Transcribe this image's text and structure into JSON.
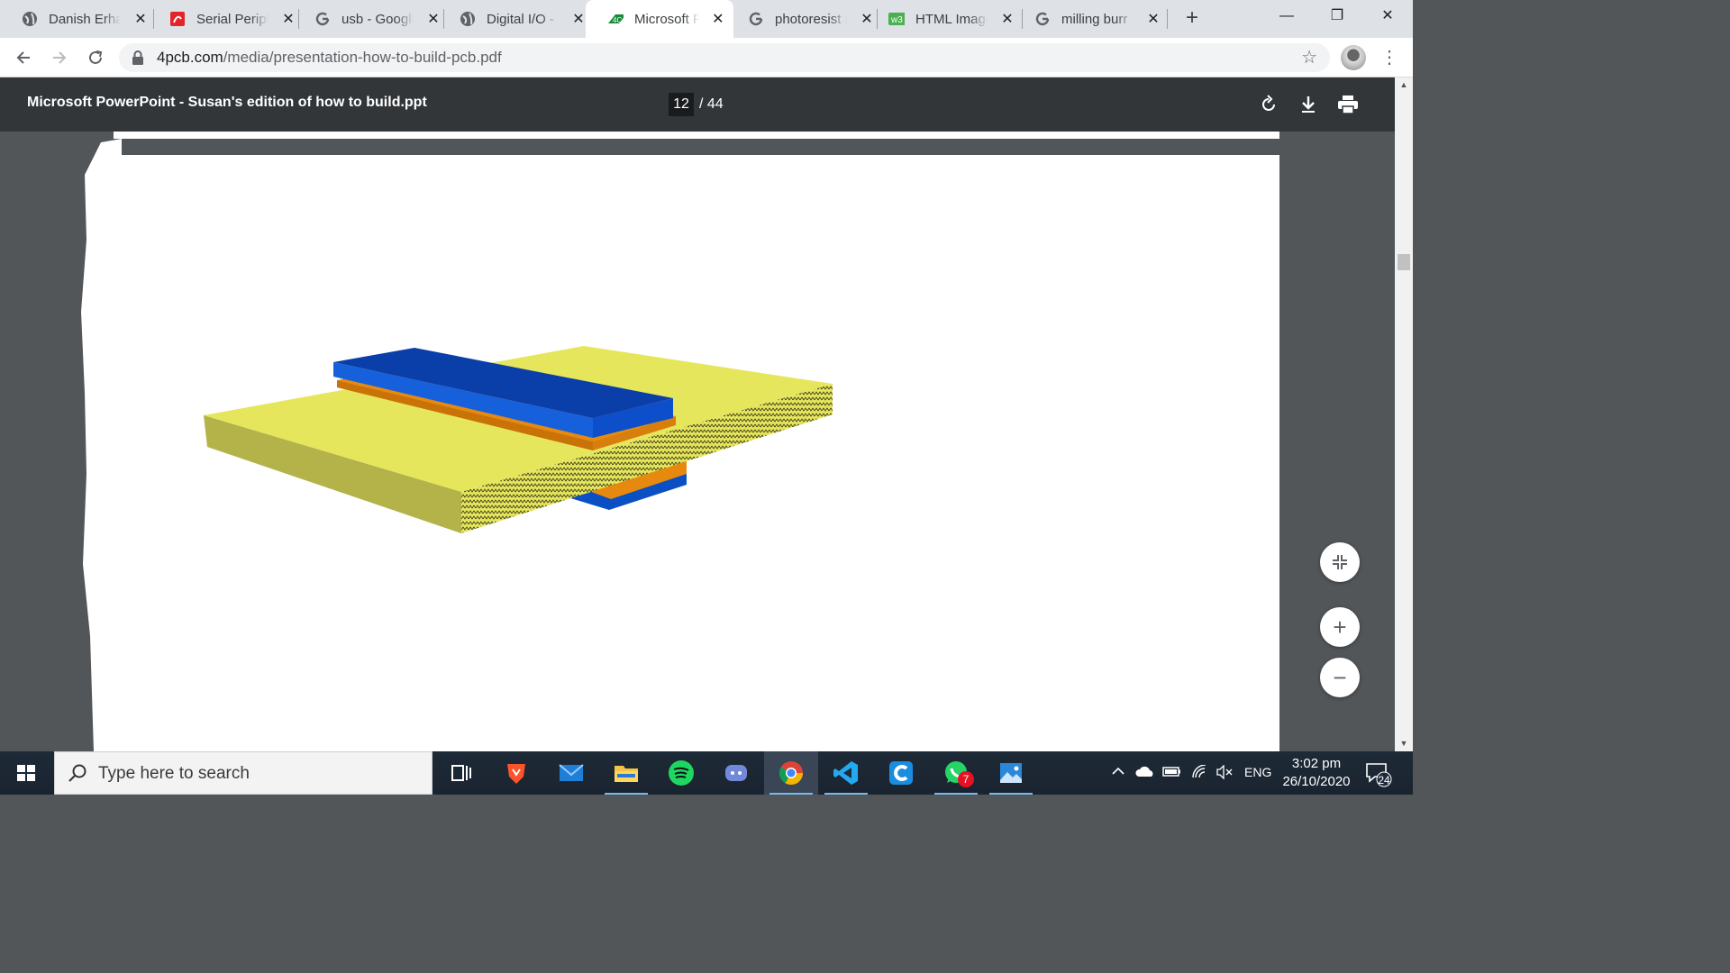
{
  "tabs": [
    {
      "title": "Danish Erhan",
      "icon": "globe-icon"
    },
    {
      "title": "Serial Peripheral",
      "icon": "pdf-icon"
    },
    {
      "title": "usb - Google",
      "icon": "google-icon"
    },
    {
      "title": "Digital I/O -",
      "icon": "globe-icon"
    },
    {
      "title": "Microsoft Po",
      "icon": "4pcb-icon",
      "active": true
    },
    {
      "title": "photoresist p",
      "icon": "google-icon"
    },
    {
      "title": "HTML Image",
      "icon": "w3schools-icon"
    },
    {
      "title": "milling burr",
      "icon": "google-icon"
    }
  ],
  "close_glyph": "✕",
  "new_tab_glyph": "+",
  "window_controls": {
    "minimize": "—",
    "restore": "❐",
    "close": "✕"
  },
  "address": {
    "domain": "4pcb.com",
    "path": "/media/presentation-how-to-build-pcb.pdf"
  },
  "pdf": {
    "title": "Microsoft PowerPoint - Susan's edition of how to build.ppt",
    "current_page": "12",
    "total_pages": "/ 44"
  },
  "zoom": {
    "fit": "⤡",
    "in": "+",
    "out": "−"
  },
  "taskbar": {
    "search_placeholder": "Type here to search",
    "apps": [
      "task-view",
      "brave",
      "mail",
      "file-explorer",
      "spotify",
      "discord",
      "chrome",
      "vscode",
      "ccleaner",
      "whatsapp",
      "photos"
    ],
    "whatsapp_badge": "7",
    "language": "ENG",
    "time": "3:02 pm",
    "date": "26/10/2020",
    "notifications": "24"
  },
  "colors": {
    "board_top": "#e6e65c",
    "board_side": "#b3b34a",
    "copper": "#e8890f",
    "blue_layer": "#0a4fc4"
  }
}
